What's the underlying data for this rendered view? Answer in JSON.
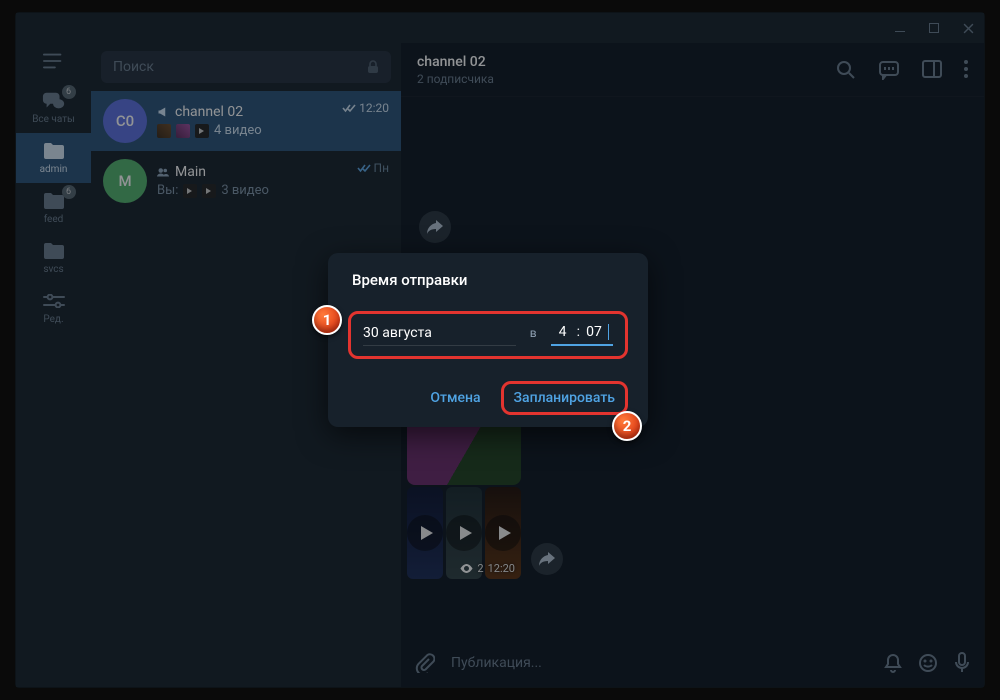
{
  "window": {
    "title": ""
  },
  "rail": {
    "items": [
      {
        "id": "all",
        "label": "Все чаты",
        "badge": "6"
      },
      {
        "id": "admin",
        "label": "admin",
        "badge": null
      },
      {
        "id": "feed",
        "label": "feed",
        "badge": "6"
      },
      {
        "id": "svcs",
        "label": "svcs",
        "badge": null
      },
      {
        "id": "edit",
        "label": "Ред.",
        "badge": null
      }
    ]
  },
  "search": {
    "placeholder": "Поиск"
  },
  "chats": [
    {
      "avatar": "C0",
      "avatar_bg": "#5b6fe0",
      "name": "channel 02",
      "preview": "4 видео",
      "time": "12:20",
      "is_channel": true,
      "active": true,
      "read": "double"
    },
    {
      "avatar": "M",
      "avatar_bg": "#53b36e",
      "name": "Main",
      "preview_prefix": "Вы:",
      "preview": "3 видео",
      "time": "Пн",
      "is_group": true,
      "active": false,
      "read": "double"
    }
  ],
  "header": {
    "title": "channel 02",
    "subtitle": "2 подписчика"
  },
  "video_meta": {
    "views": "2",
    "time": "12:20"
  },
  "composer": {
    "placeholder": "Публикация..."
  },
  "dialog": {
    "title": "Время отправки",
    "date": "30 августа",
    "at": "в",
    "hour": "4",
    "minute": "07",
    "cancel": "Отмена",
    "schedule": "Запланировать"
  },
  "callouts": {
    "c1": "1",
    "c2": "2"
  }
}
